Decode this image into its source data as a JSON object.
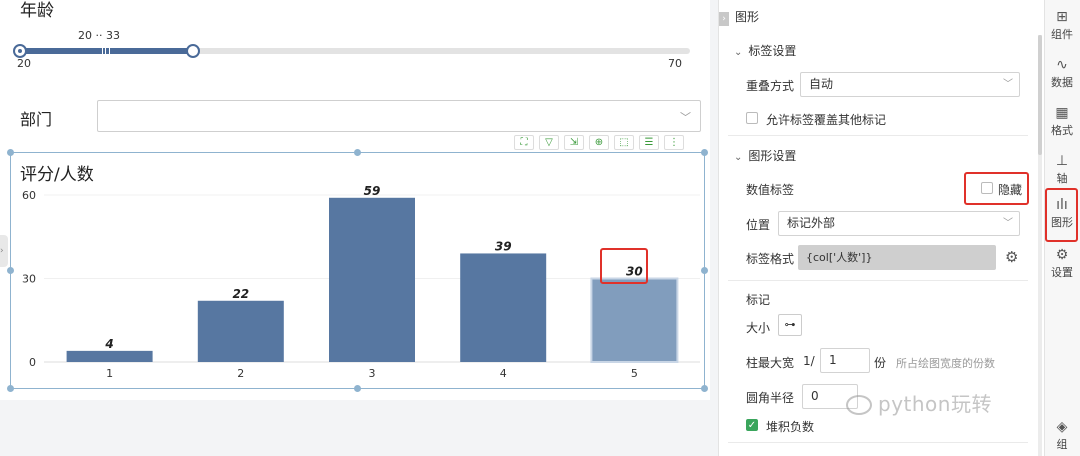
{
  "filters": {
    "age": {
      "title": "年龄",
      "range_value": "20 ·· 33",
      "min": "20",
      "max": "70",
      "selected_low": 20,
      "selected_high": 33
    },
    "dept": {
      "title": "部门",
      "value": ""
    }
  },
  "chart_toolbar": [
    "fullscreen-icon",
    "filter-icon",
    "export-icon",
    "zoom-icon",
    "select-icon",
    "list-icon",
    "more-icon"
  ],
  "chart_data": {
    "type": "bar",
    "title": "评分/人数",
    "categories": [
      "1",
      "2",
      "3",
      "4",
      "5"
    ],
    "values": [
      4,
      22,
      59,
      39,
      30
    ],
    "data_labels": [
      "4",
      "22",
      "59",
      "39",
      "30"
    ],
    "highlighted_index": 4,
    "ylim": [
      0,
      60
    ],
    "yticks": [
      "60",
      "30",
      "0"
    ],
    "xlabel": "",
    "ylabel": "",
    "grid": true,
    "bar_color": "#5777a1",
    "highlight_color": "#819dbd"
  },
  "panel": {
    "header": "图形",
    "label_settings": {
      "title": "标签设置",
      "overlap_label": "重叠方式",
      "overlap_value": "自动",
      "allow_cover_label": "允许标签覆盖其他标记"
    },
    "graphic_settings": {
      "title": "图形设置",
      "value_label": "数值标签",
      "hide_label": "隐藏",
      "position_label": "位置",
      "position_value": "标记外部",
      "format_label": "标签格式",
      "format_value": "{col['人数']}",
      "marks_label": "标记",
      "size_label": "大小",
      "bar_width_label": "柱最大宽",
      "bar_width_prefix": "1/",
      "bar_width_value": "1",
      "bar_width_unit": "份",
      "bar_width_hint": "所占绘图宽度的份数",
      "corner_label": "圆角半径",
      "corner_value": "0",
      "stack_negative_label": "堆积负数"
    }
  },
  "rail": {
    "items": [
      {
        "label": "组件",
        "icon": "component-icon"
      },
      {
        "label": "数据",
        "icon": "data-icon"
      },
      {
        "label": "格式",
        "icon": "format-icon"
      },
      {
        "label": "轴",
        "icon": "axis-icon"
      },
      {
        "label": "图形",
        "icon": "graph-icon"
      },
      {
        "label": "设置",
        "icon": "settings-icon"
      },
      {
        "label": "组",
        "icon": "layers-icon"
      }
    ]
  },
  "watermark": "python玩转"
}
